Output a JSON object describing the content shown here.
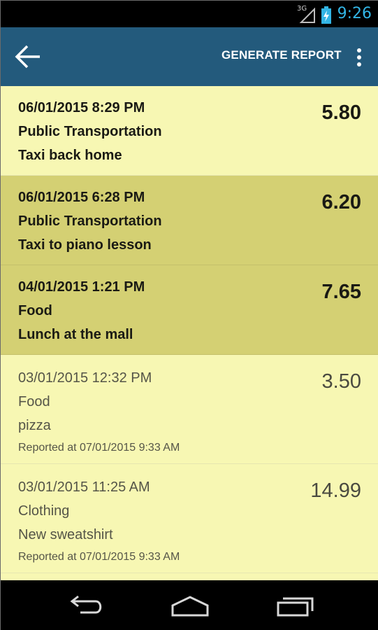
{
  "status": {
    "network": "3G",
    "time": "9:26"
  },
  "action_bar": {
    "report_label": "GENERATE REPORT"
  },
  "colors": {
    "action_bar": "#235a7c",
    "list_bg": "#f7f7b3",
    "selected_bg": "#d4d073",
    "clock": "#33b5e5"
  },
  "icons": {
    "back": "arrow-left-icon",
    "overflow": "more-vert-icon",
    "nav_back": "nav-back-icon",
    "nav_home": "nav-home-icon",
    "nav_recents": "nav-recents-icon"
  },
  "expenses": [
    {
      "datetime": "06/01/2015  8:29 PM",
      "category": "Public Transportation",
      "note": "Taxi back home",
      "amount": "5.80",
      "reported": "",
      "selected": false,
      "style": "bold"
    },
    {
      "datetime": "06/01/2015  6:28 PM",
      "category": "Public Transportation",
      "note": "Taxi to piano lesson",
      "amount": "6.20",
      "reported": "",
      "selected": true,
      "style": "bold"
    },
    {
      "datetime": "04/01/2015  1:21 PM",
      "category": "Food",
      "note": "Lunch at the mall",
      "amount": "7.65",
      "reported": "",
      "selected": true,
      "style": "bold"
    },
    {
      "datetime": "03/01/2015  12:32 PM",
      "category": "Food",
      "note": "pizza",
      "amount": "3.50",
      "reported": "Reported at 07/01/2015  9:33 AM",
      "selected": false,
      "style": "light"
    },
    {
      "datetime": "03/01/2015  11:25 AM",
      "category": "Clothing",
      "note": "New sweatshirt",
      "amount": "14.99",
      "reported": "Reported at 07/01/2015  9:33 AM",
      "selected": false,
      "style": "light"
    }
  ]
}
